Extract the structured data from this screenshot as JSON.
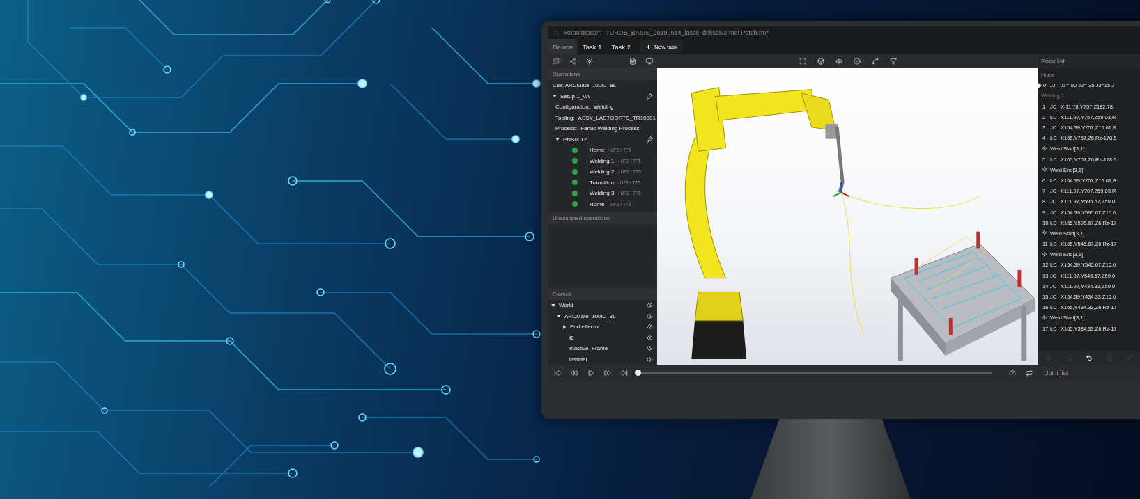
{
  "window": {
    "title": "Robotmaster - TUROB_BASIS_20190914_lascel dekselv2 met Patch.rm*"
  },
  "tabs": [
    {
      "label": "Device",
      "selected": true
    },
    {
      "label": "Task 1",
      "selected": false
    },
    {
      "label": "Task 2",
      "selected": false
    }
  ],
  "new_task_button": {
    "label": "New task"
  },
  "operations": {
    "title": "Operations",
    "cell": "Cell: ARCMate_100iC_8L",
    "setups": [
      {
        "name": "Setup 1_VA",
        "expanded": true,
        "properties": [
          {
            "label": "Configuration:",
            "value": "Welding"
          },
          {
            "label": "Tooling:",
            "value": "ASSY_LASTOORTS_TR19001"
          },
          {
            "label": "Process:",
            "value": "Fanuc Welding Process"
          }
        ],
        "programs": [
          {
            "name": "PNS0012",
            "expanded": true,
            "operations": [
              {
                "name": "Home",
                "frame": "- UF2 / TF5",
                "color": "#2ea043"
              },
              {
                "name": "Welding 1",
                "frame": "- UF2 / TF5",
                "color": "#2ea043"
              },
              {
                "name": "Welding 2",
                "frame": "- UF2 / TF5",
                "color": "#2ea043"
              },
              {
                "name": "Transition",
                "frame": "- UF2 / TF5",
                "color": "#2ea043"
              },
              {
                "name": "Welding 3",
                "frame": "- UF2 / TF5",
                "color": "#2ea043"
              },
              {
                "name": "Home",
                "frame": "- UF2 / TF5",
                "color": "#2ea043"
              }
            ]
          }
        ]
      }
    ]
  },
  "unassigned": {
    "title": "Unassigned operations"
  },
  "frames": {
    "title": "Frames",
    "items": [
      {
        "name": "World",
        "expanded": true,
        "children": [
          {
            "name": "ARCMate_100iC_8L",
            "expanded": true,
            "children": [
              {
                "name": "End effector",
                "expanded": false
              },
              {
                "name": "f2"
              },
              {
                "name": "Inactive_Frame"
              },
              {
                "name": "lastafel"
              }
            ]
          }
        ]
      }
    ]
  },
  "point_list": {
    "title": "Point list",
    "rows": [
      {
        "kind": "group",
        "label": "Home"
      },
      {
        "kind": "current",
        "num": "0",
        "type": "JJ",
        "value": "J1=-90 J2=-35 J3=15 J"
      },
      {
        "kind": "group",
        "label": "Welding 1"
      },
      {
        "kind": "point",
        "num": "1",
        "type": "JC",
        "value": "X-11.78,Y757,Z182.78,"
      },
      {
        "kind": "point",
        "num": "2",
        "type": "LC",
        "value": "X111.97,Y757,Z59.03,R"
      },
      {
        "kind": "point",
        "num": "3",
        "type": "JC",
        "value": "X154.39,Y757,Z16.61,R"
      },
      {
        "kind": "point",
        "num": "4",
        "type": "LC",
        "value": "X165,Y757,Z6,Rz-178.5"
      },
      {
        "kind": "event",
        "label": "Weld Start[3,1]"
      },
      {
        "kind": "point",
        "num": "5",
        "type": "LC",
        "value": "X165,Y707,Z6,Rz-178.5"
      },
      {
        "kind": "event",
        "label": "Weld End[3,1]"
      },
      {
        "kind": "point",
        "num": "6",
        "type": "LC",
        "value": "X154.39,Y707,Z16.61,R"
      },
      {
        "kind": "point",
        "num": "7",
        "type": "JC",
        "value": "X111.97,Y707,Z59.03,R"
      },
      {
        "kind": "point",
        "num": "8",
        "type": "JC",
        "value": "X111.97,Y595.67,Z59.0"
      },
      {
        "kind": "point",
        "num": "9",
        "type": "JC",
        "value": "X154.39,Y595.67,Z16.6"
      },
      {
        "kind": "point",
        "num": "10",
        "type": "LC",
        "value": "X165,Y595.67,Z6,Rz-17"
      },
      {
        "kind": "event",
        "label": "Weld Start[3,1]"
      },
      {
        "kind": "point",
        "num": "11",
        "type": "LC",
        "value": "X165,Y545.67,Z6,Rz-17"
      },
      {
        "kind": "event",
        "label": "Weld End[3,1]"
      },
      {
        "kind": "point",
        "num": "12",
        "type": "LC",
        "value": "X154.39,Y545.67,Z16.6"
      },
      {
        "kind": "point",
        "num": "13",
        "type": "JC",
        "value": "X111.97,Y545.67,Z59.0"
      },
      {
        "kind": "point",
        "num": "14",
        "type": "JC",
        "value": "X111.97,Y434.33,Z59.0"
      },
      {
        "kind": "point",
        "num": "15",
        "type": "JC",
        "value": "X154.39,Y434.33,Z16.6"
      },
      {
        "kind": "point",
        "num": "16",
        "type": "LC",
        "value": "X165,Y434.33,Z6,Rz-17"
      },
      {
        "kind": "event",
        "label": "Weld Start[3,1]"
      },
      {
        "kind": "point",
        "num": "17",
        "type": "LC",
        "value": "X165,Y384.33,Z6,Rz-17"
      }
    ]
  },
  "point_tools": [
    {
      "kind": "weld",
      "disabled": true
    },
    {
      "kind": "list",
      "disabled": true
    },
    {
      "kind": "undo",
      "disabled": false
    },
    {
      "kind": "delete",
      "disabled": true
    },
    {
      "kind": "edit",
      "disabled": true
    }
  ],
  "playback": {
    "level": 0
  },
  "joint_list": {
    "label": "Joint list"
  }
}
